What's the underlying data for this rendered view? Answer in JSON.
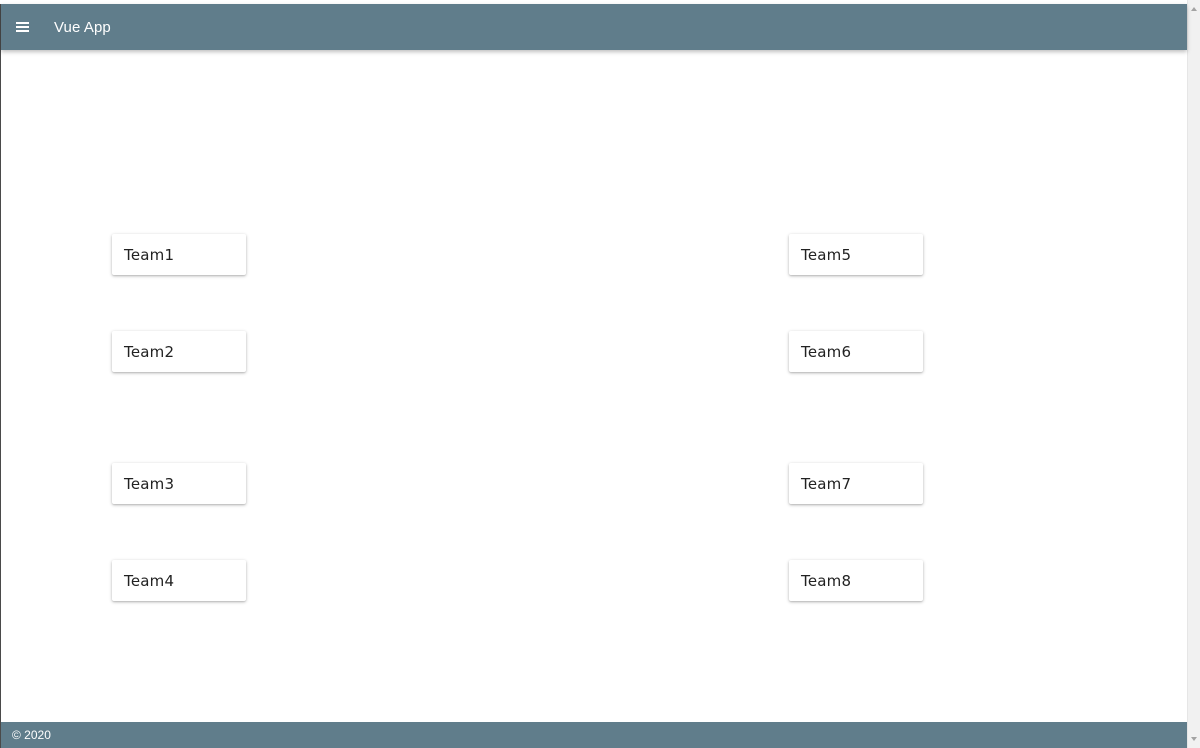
{
  "header": {
    "title": "Vue App",
    "menu_icon": "menu-icon",
    "color": "#607d8b"
  },
  "teams": {
    "left": [
      "Team1",
      "Team2",
      "Team3",
      "Team4"
    ],
    "right": [
      "Team5",
      "Team6",
      "Team7",
      "Team8"
    ]
  },
  "footer": {
    "text": "© 2020",
    "color": "#607d8b"
  }
}
